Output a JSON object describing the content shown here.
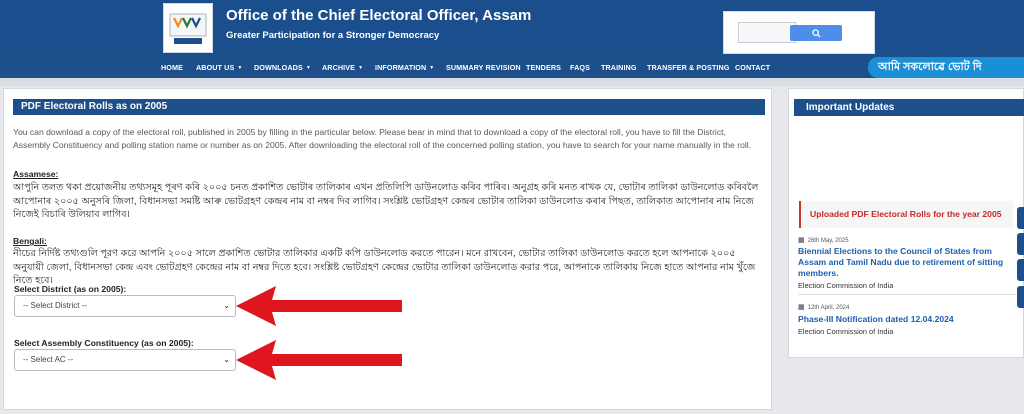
{
  "header": {
    "title": "Office of the Chief Electoral Officer, Assam",
    "tagline": "Greater Participation for a Stronger Democracy"
  },
  "nav": {
    "items": [
      {
        "label": "HOME",
        "caret": false
      },
      {
        "label": "ABOUT US",
        "caret": true
      },
      {
        "label": "DOWNLOADS",
        "caret": true
      },
      {
        "label": "ARCHIVE",
        "caret": true
      },
      {
        "label": "INFORMATION",
        "caret": true
      },
      {
        "label": "SUMMARY REVISION",
        "caret": false
      },
      {
        "label": "TENDERS",
        "caret": false
      },
      {
        "label": "FAQS",
        "caret": false
      },
      {
        "label": "TRAINING",
        "caret": false
      },
      {
        "label": "TRANSFER & POSTING",
        "caret": false
      },
      {
        "label": "CONTACT",
        "caret": false
      }
    ],
    "marquee": "আমি সকলোৱে ভোট দি"
  },
  "main": {
    "header": "PDF Electoral Rolls as on 2005",
    "intro": "You can download a copy of the electoral roll, published in 2005 by filling in the particular below. Please bear in mind that to download a copy of the electoral roll, you have to fill the District, Assembly Constituency and polling station name or number as on 2005. After downloading the electoral roll of the concerned polling station, you have to search for your name manually in the roll.",
    "assamese_title": "Assamese:",
    "assamese_text": "আপুনি তলত থকা প্ৰয়োজনীয় তথ্যসমূহ পূৰণ কৰি ২০০৫ চনত প্ৰকাশিত ভোটাৰ তালিকাৰ এখন প্ৰতিলিপি ডাউনলোড কৰিব পাৰিব। অনুগ্ৰহ কৰি মনত ৰাখক যে, ভোটাৰ তালিকা ডাউনলোড কৰিবলৈ আপোনাৰ ২০০৫ অনুসৰি জিলা, বিধানসভা সমষ্টি আৰু ভোটগ্ৰহণ কেন্দ্ৰৰ নাম বা নম্বৰ দিব লাগিব। সংশ্লিষ্ট ভোটগ্ৰহণ কেন্দ্ৰৰ ভোটাৰ তালিকা ডাউনলোড কৰাৰ পিছত, তালিকাত আপোনাৰ নাম নিজে নিজেই বিচাৰি উলিয়াব লাগিব।",
    "bengali_title": "Bengali:",
    "bengali_text": "নীচের নির্দিষ্ট তথ্যগুলি পূরণ করে আপনি ২০০৫ সালে প্রকাশিত ভোটার তালিকার একটি কপি ডাউনলোড করতে পারেন। মনে রাখবেন, ভোটার তালিকা ডাউনলোড করতে হলে আপনাকে ২০০৫ অনুযায়ী জেলা, বিধানসভা কেন্দ্র এবং ভোটগ্রহণ কেন্দ্রের নাম বা নম্বর দিতে হবে। সংশ্লিষ্ট ভোটগ্রহণ কেন্দ্রের ভোটার তালিকা ডাউনলোড করার পরে, আপনাকে তালিকায় নিজে হাতে আপনার নাম খুঁজে নিতে হবে।",
    "district_label": "Select District (as on 2005):",
    "district_value": "-- Select District --",
    "ac_label": "Select Assembly Constituency (as on 2005):",
    "ac_value": "-- Select AC --"
  },
  "sidebar": {
    "header": "Important Updates",
    "banner": "Uploaded PDF Electoral Rolls for the year 2005",
    "updates": [
      {
        "date": "26th May, 2025",
        "title": "Biennial Elections to the Council of States from Assam and Tamil Nadu due to retirement of sitting members.",
        "source": "Election Commission of India"
      },
      {
        "date": "12th April, 2024",
        "title": "Phase-III Notification dated 12.04.2024",
        "source": "Election Commission of India"
      }
    ]
  },
  "colors": {
    "header_bg": "#1b4e8c",
    "accent_red": "#e0161e",
    "link_blue": "#1d5fb0"
  },
  "icons": [
    "calendar-icon",
    "chevron-down-icon",
    "search-icon"
  ]
}
